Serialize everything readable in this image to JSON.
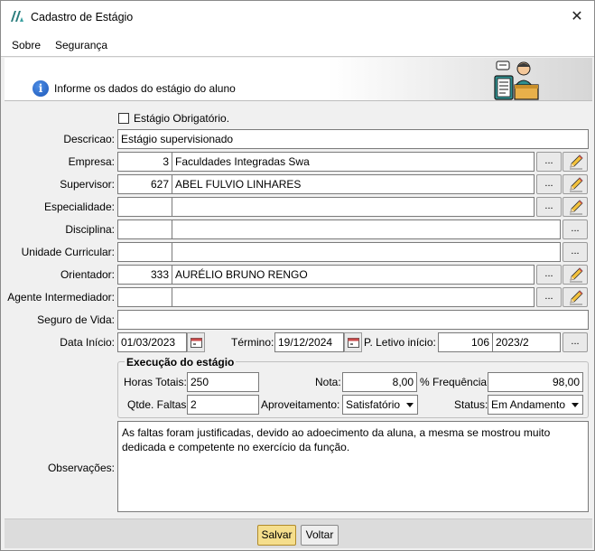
{
  "window": {
    "title": "Cadastro de Estágio",
    "close": "✕"
  },
  "menu": {
    "sobre": "Sobre",
    "seguranca": "Segurança"
  },
  "header": {
    "text": "Informe os dados do estágio do aluno"
  },
  "form": {
    "obrigatorio_label": "Estágio Obrigatório.",
    "descricao_label": "Descricao:",
    "descricao_value": "Estágio supervisionado",
    "empresa_label": "Empresa:",
    "empresa_code": "3",
    "empresa_name": "Faculdades Integradas Swa",
    "supervisor_label": "Supervisor:",
    "supervisor_code": "627",
    "supervisor_name": "ABEL FULVIO LINHARES",
    "especialidade_label": "Especialidade:",
    "disciplina_label": "Disciplina:",
    "unidade_label": "Unidade Curricular:",
    "orientador_label": "Orientador:",
    "orientador_code": "333",
    "orientador_name": "AURÉLIO BRUNO RENGO",
    "agente_label": "Agente Intermediador:",
    "seguro_label": "Seguro de Vida:",
    "data_inicio_label": "Data Início:",
    "data_inicio_value": "01/03/2023",
    "termino_label": "Término:",
    "termino_value": "19/12/2024",
    "periodo_label": "P. Letivo início:",
    "periodo_code": "106",
    "periodo_value": "2023/2",
    "lookup": "...",
    "observacoes_label": "Observações:",
    "observacoes_value": "As faltas foram justificadas, devido ao adoecimento da aluna, a mesma se mostrou muito dedicada e competente no exercício da função."
  },
  "execucao": {
    "title": "Execução do estágio",
    "horas_label": "Horas Totais:",
    "horas_value": "250",
    "nota_label": "Nota:",
    "nota_value": "8,00",
    "frequencia_label": "% Frequência:",
    "frequencia_value": "98,00",
    "faltas_label": "Qtde. Faltas:",
    "faltas_value": "2",
    "aproveitamento_label": "Aproveitamento:",
    "aproveitamento_value": "Satisfatório",
    "status_label": "Status:",
    "status_value": "Em Andamento"
  },
  "footer": {
    "salvar": "Salvar",
    "voltar": "Voltar"
  },
  "colors": {
    "accent": "#f5de8c",
    "info": "#1c56b8"
  }
}
